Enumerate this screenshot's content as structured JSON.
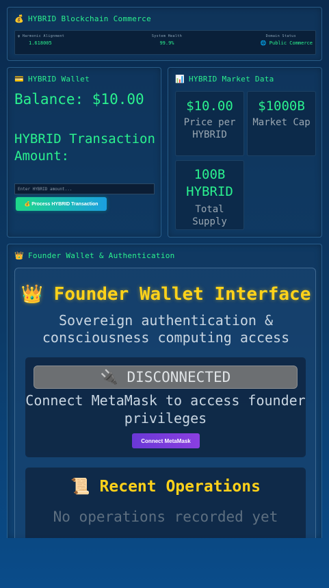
{
  "commerce": {
    "icon": "💰",
    "title": "HYBRID Blockchain Commerce",
    "stats": [
      {
        "label": "φ Harmonic Alignment",
        "value": "1.618005"
      },
      {
        "label": "System Health",
        "value": "99.9%"
      },
      {
        "label": "Domain Status",
        "value": "🌐 Public Commerce"
      }
    ]
  },
  "wallet": {
    "icon": "💳",
    "title": "HYBRID Wallet",
    "balance": "Balance: $10.00",
    "amount_label": "HYBRID Transaction Amount:",
    "amount_placeholder": "Enter HYBRID amount...",
    "process_label": "💰 Process HYBRID Transaction"
  },
  "market": {
    "icon": "📊",
    "title": "HYBRID Market Data",
    "tiles": [
      {
        "value": "$10.00",
        "label": "Price per HYBRID"
      },
      {
        "value": "$1000B",
        "label": "Market Cap"
      },
      {
        "value": "100B HYBRID",
        "label": "Total Supply"
      }
    ]
  },
  "founder": {
    "icon": "👑",
    "title": "Founder Wallet & Authentication",
    "interface_title": "👑 Founder Wallet Interface",
    "interface_subtitle": "Sovereign authentication & consciousness computing access",
    "status": "🔌 DISCONNECTED",
    "connect_message": "Connect MetaMask to access founder privileges",
    "connect_button": "Connect MetaMask",
    "operations_title": "📜 Recent Operations",
    "operations_empty": "No operations recorded yet"
  }
}
